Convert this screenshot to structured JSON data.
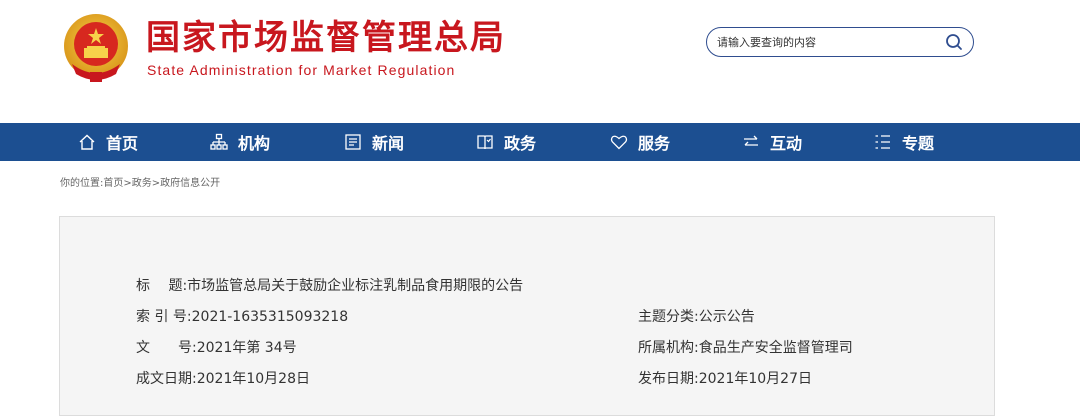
{
  "header": {
    "title_cn": "国家市场监督管理总局",
    "title_en": "State Administration for Market Regulation",
    "brand_color": "#c8171e"
  },
  "search": {
    "placeholder": "请输入要查询的内容",
    "icon": "search-icon"
  },
  "nav": {
    "background": "#1c4f91",
    "items": [
      {
        "label": "首页",
        "icon": "home-icon"
      },
      {
        "label": "机构",
        "icon": "org-chart-icon"
      },
      {
        "label": "新闻",
        "icon": "news-icon"
      },
      {
        "label": "政务",
        "icon": "book-icon"
      },
      {
        "label": "服务",
        "icon": "heart-icon"
      },
      {
        "label": "互动",
        "icon": "exchange-icon"
      },
      {
        "label": "专题",
        "icon": "list-icon"
      }
    ]
  },
  "breadcrumb": {
    "prefix": "你的位置:",
    "items": [
      "首页",
      "政务",
      "政府信息公开"
    ],
    "separator": ">"
  },
  "document": {
    "title_label": "标　 题:",
    "title_value": "市场监管总局关于鼓励企业标注乳制品食用期限的公告",
    "index_label": "索 引 号:",
    "index_value": "2021-1635315093218",
    "number_label": "文　　号:",
    "number_value": "2021年第 34号",
    "created_label": "成文日期:",
    "created_value": "2021年10月28日",
    "category_label": "主题分类:",
    "category_value": "公示公告",
    "agency_label": "所属机构:",
    "agency_value": "食品生产安全监督管理司",
    "published_label": "发布日期:",
    "published_value": "2021年10月27日"
  }
}
